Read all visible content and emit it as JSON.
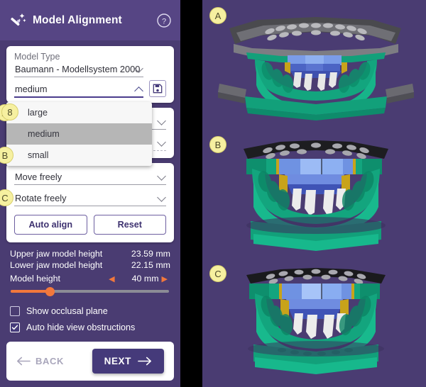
{
  "header": {
    "title": "Model Alignment",
    "wand_icon": "magic-wand-icon",
    "help_icon": "help-circle-icon"
  },
  "model_type_card": {
    "label": "Model Type",
    "system_value": "Baumann - Modellsystem 2000",
    "size_value": "medium",
    "save_icon": "floppy-save-icon",
    "badge": "8"
  },
  "size_dropdown": {
    "open": true,
    "selected": "medium",
    "options": [
      {
        "label": "large",
        "badge": "A",
        "selected": false
      },
      {
        "label": "medium",
        "badge": "B",
        "selected": true
      },
      {
        "label": "small",
        "badge": "C",
        "selected": false
      }
    ]
  },
  "motion_card": {
    "move_value": "Move freely",
    "rotate_value": "Rotate freely",
    "auto_align_label": "Auto align",
    "reset_label": "Reset"
  },
  "measurements": [
    {
      "label": "Upper jaw model height",
      "value": "23.59 mm"
    },
    {
      "label": "Lower jaw model height",
      "value": "22.15 mm"
    }
  ],
  "slider": {
    "label": "Model height",
    "value": "40 mm",
    "percent": 25,
    "dec_icon": "triangle-left-icon",
    "inc_icon": "triangle-right-icon"
  },
  "checkboxes": [
    {
      "label": "Show occlusal plane",
      "checked": false
    },
    {
      "label": "Auto hide view obstructions",
      "checked": true
    }
  ],
  "footer": {
    "back_label": "BACK",
    "next_label": "NEXT",
    "back_icon": "arrow-left-icon",
    "next_icon": "arrow-right-icon"
  },
  "viewport": {
    "views": [
      {
        "badge": "A",
        "name": "dental-model-view-large"
      },
      {
        "badge": "B",
        "name": "dental-model-view-medium"
      },
      {
        "badge": "C",
        "name": "dental-model-view-small"
      }
    ]
  },
  "colors": {
    "panel_purple": "#4a3c72",
    "header_purple": "#564584",
    "accent_purple": "#453a7a",
    "slider_orange": "#f2783c",
    "badge_yellow": "#f6f0a0",
    "model_teal": "#19a87f",
    "model_blue": "#5b7fd4",
    "model_gray": "#8f8f95"
  }
}
